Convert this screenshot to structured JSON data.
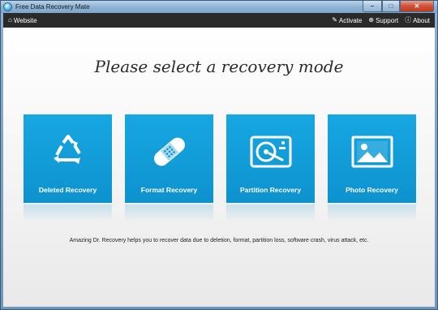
{
  "window": {
    "title": "Free Data Recovery Mate",
    "controls": {
      "minimize": "–",
      "maximize": "□",
      "close": "✕"
    }
  },
  "appbar": {
    "website": {
      "icon": "home-icon",
      "label": "Website"
    },
    "activate": {
      "icon": "wrench-icon",
      "label": "Activate"
    },
    "support": {
      "icon": "lifebuoy-icon",
      "label": "Support"
    },
    "about": {
      "icon": "info-icon",
      "label": "About"
    }
  },
  "main": {
    "heading": "Please select a recovery mode",
    "tiles": [
      {
        "label": "Deleted Recovery",
        "icon": "recycle-icon"
      },
      {
        "label": "Format Recovery",
        "icon": "bandage-icon"
      },
      {
        "label": "Partition Recovery",
        "icon": "hard-drive-icon"
      },
      {
        "label": "Photo Recovery",
        "icon": "photo-icon"
      }
    ],
    "description": "Amazing Dr. Recovery helps you to recover data due to deletion, format, partition loss, software crash, virus attack, etc."
  },
  "colors": {
    "tile": "#0d92cf",
    "appbar": "#2a2a2a",
    "close_button": "#c03a1f"
  }
}
